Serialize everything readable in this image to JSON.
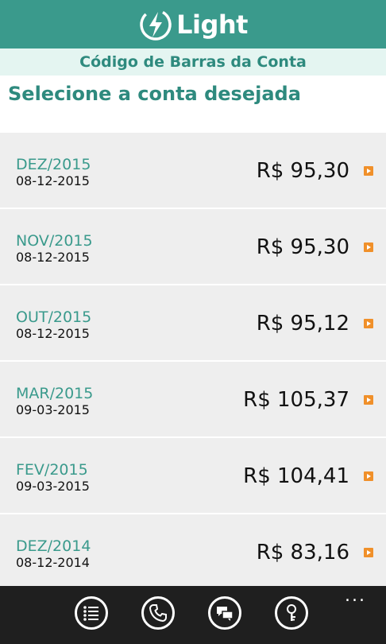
{
  "header": {
    "app_name": "Light"
  },
  "subheader": {
    "title": "Código de Barras da Conta"
  },
  "page": {
    "title": "Selecione a conta desejada"
  },
  "bills": [
    {
      "month": "DEZ/2015",
      "date": "08-12-2015",
      "value": "R$ 95,30"
    },
    {
      "month": "NOV/2015",
      "date": "08-12-2015",
      "value": "R$ 95,30"
    },
    {
      "month": "OUT/2015",
      "date": "08-12-2015",
      "value": "R$ 95,12"
    },
    {
      "month": "MAR/2015",
      "date": "09-03-2015",
      "value": "R$ 105,37"
    },
    {
      "month": "FEV/2015",
      "date": "09-03-2015",
      "value": "R$ 104,41"
    },
    {
      "month": "DEZ/2014",
      "date": "08-12-2014",
      "value": "R$ 83,16"
    }
  ],
  "appbar": {
    "buttons": [
      "list-icon",
      "phone-icon",
      "chat-icon",
      "key-icon"
    ],
    "more_label": "..."
  },
  "colors": {
    "brand": "#3a9a8c",
    "subheader_bg": "#e4f5f1",
    "row_bg": "#eeeeee",
    "arrow": "#f0902a",
    "appbar_bg": "#1f1f1f"
  }
}
